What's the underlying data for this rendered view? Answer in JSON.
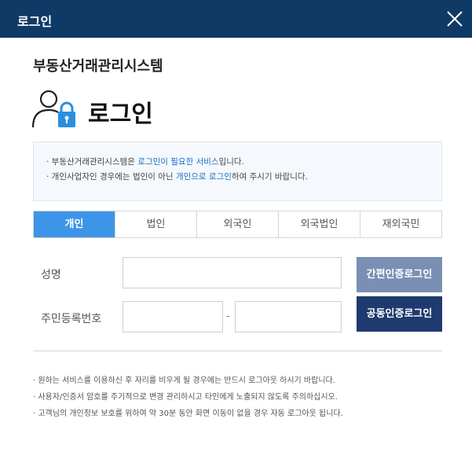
{
  "window": {
    "title": "로그인"
  },
  "system_title": "부동산거래관리시스템",
  "login_heading": "로그인",
  "info": {
    "line1_prefix": "· 부동산거래관리시스템은 ",
    "line1_highlight": "로그인이 필요한 서비스",
    "line1_suffix": "입니다.",
    "line2_prefix": "· 개인사업자인 경우에는 법인이 아닌 ",
    "line2_highlight": "개인으로 로그인",
    "line2_suffix": "하여 주시기 바랍니다."
  },
  "tabs": [
    {
      "label": "개인",
      "active": true
    },
    {
      "label": "법인",
      "active": false
    },
    {
      "label": "외국인",
      "active": false
    },
    {
      "label": "외국법인",
      "active": false
    },
    {
      "label": "재외국민",
      "active": false
    }
  ],
  "form": {
    "name_label": "성명",
    "rrn_label": "주민등록번호",
    "rrn_separator": "-"
  },
  "buttons": {
    "simple_auth": "간편인증로그인",
    "cert_login": "공동인증로그인"
  },
  "notes": [
    "· 원하는 서비스를 이용하신 후 자리를 비우게 될 경우에는 반드시 로그아웃 하시기 바랍니다.",
    "· 사용자/인증서 암호를 주기적으로 변경 관리하시고 타인에게 노출되지 않도록 주의하십시오.",
    "· 고객님의 개인정보 보호를 위하여 약 30분 동안 화면 이동이 없을 경우 자동 로그아웃 됩니다."
  ],
  "colors": {
    "titlebar": "#0f3a66",
    "active_tab": "#3d95e8",
    "highlight": "#1a6fc7",
    "simple_button": "#7a8fb4",
    "cert_button": "#1f3a6e"
  }
}
